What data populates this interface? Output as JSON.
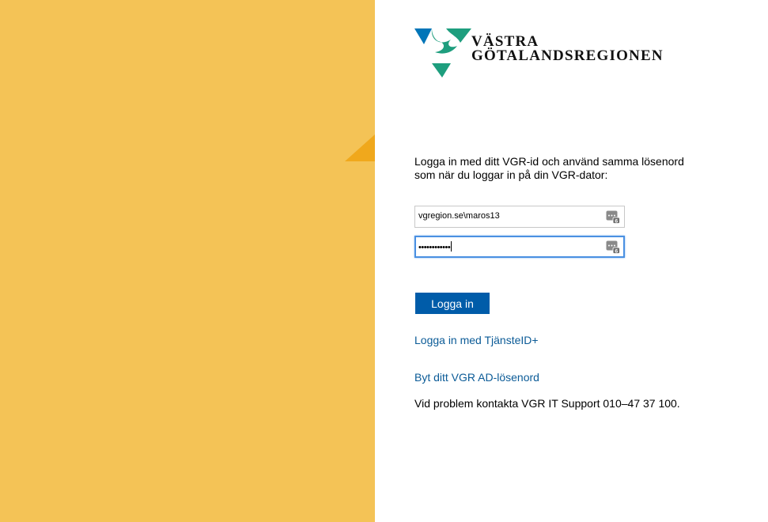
{
  "brand": {
    "line1": "VÄSTRA",
    "line2": "GÖTALANDSREGIONEN",
    "logo_icon": "vgr-logo-icon",
    "colors": {
      "blue": "#0075b8",
      "green": "#1e9e7e",
      "sidebar": "#f4c356",
      "accent": "#f0a81c"
    }
  },
  "login": {
    "intro": "Logga in med ditt VGR-id och använd samma lösenord som när du loggar in på din VGR-dator:",
    "username_value": "vgregion.se\\maros13",
    "password_value": "••••••••••••",
    "password_manager_icon": "password-manager-key-icon",
    "submit_label": "Logga in",
    "alt_login_link": "Logga in med TjänsteID+",
    "change_password_link": "Byt ditt VGR AD-lösenord",
    "support_text": "Vid problem kontakta VGR IT Support 010–47 37 100."
  }
}
